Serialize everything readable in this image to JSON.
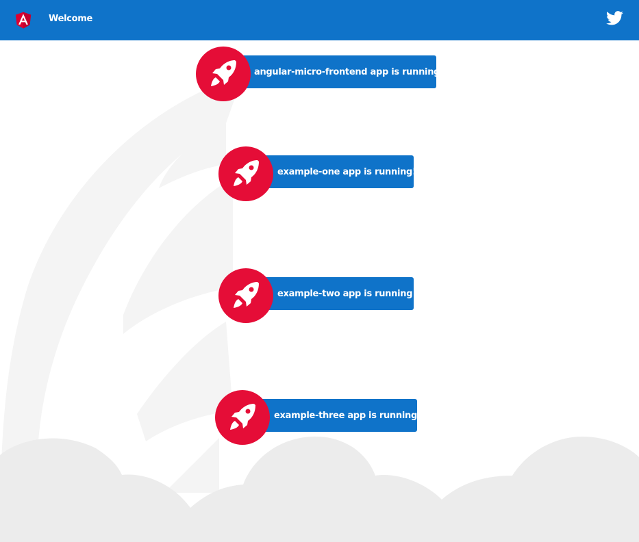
{
  "toolbar": {
    "title": "Welcome",
    "logo_icon": "angular-logo-icon",
    "social_icon": "twitter-icon"
  },
  "apps": [
    {
      "label": "angular-micro-frontend app is running!",
      "icon": "rocket-icon"
    },
    {
      "label": "example-one app is running!",
      "icon": "rocket-icon"
    },
    {
      "label": "example-two app is running!",
      "icon": "rocket-icon"
    },
    {
      "label": "example-three app is running!",
      "icon": "rocket-icon"
    }
  ],
  "colors": {
    "primary": "#0f73c9",
    "accent": "#e50d37",
    "background_art": "#f2f2f2",
    "clouds": "#ececec"
  }
}
